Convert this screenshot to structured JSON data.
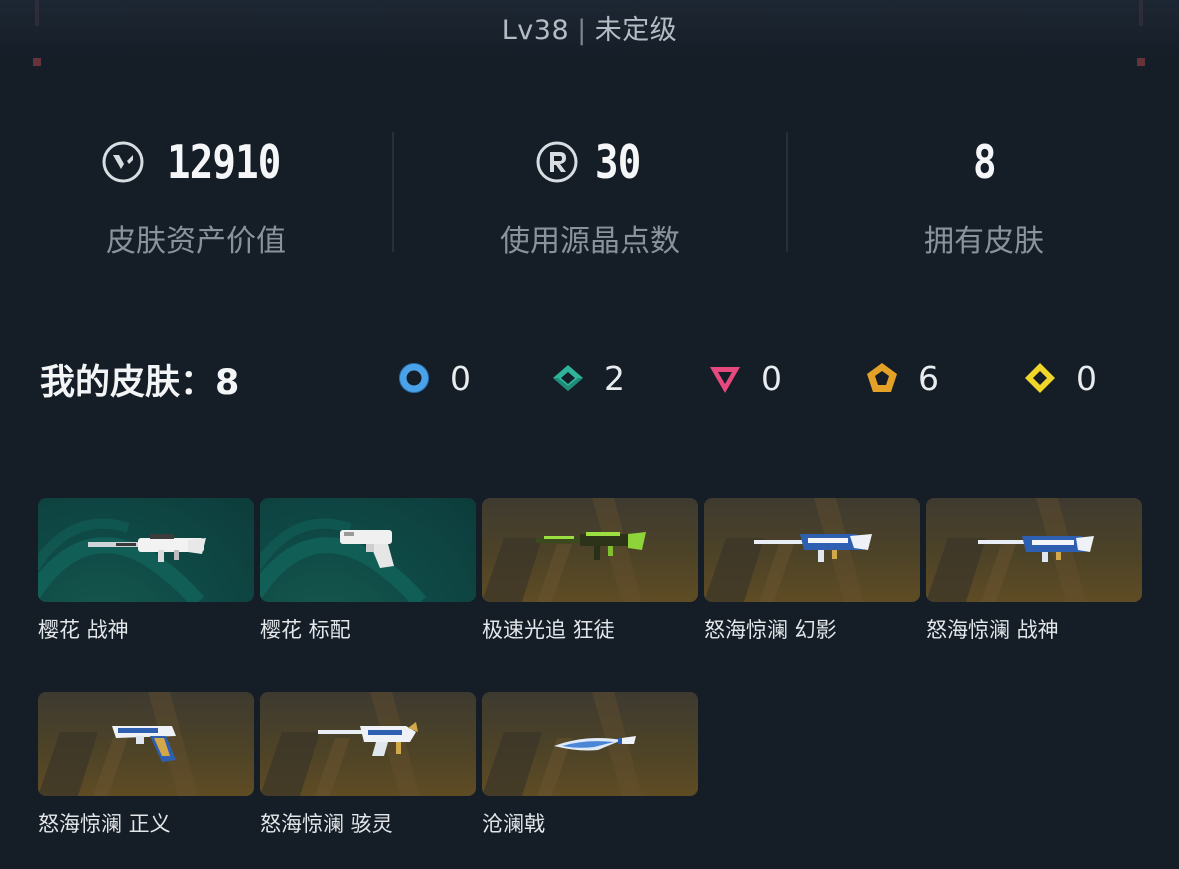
{
  "header": {
    "level": "Lv38",
    "rank": "未定级"
  },
  "stats": [
    {
      "value": "12910",
      "label": "皮肤资产价值",
      "icon": "valorant-points-icon"
    },
    {
      "value": "30",
      "label": "使用源晶点数",
      "icon": "radianite-points-icon"
    },
    {
      "value": "8",
      "label": "拥有皮肤",
      "icon": ""
    }
  ],
  "skins_summary": {
    "title": "我的皮肤：8",
    "rarities": [
      {
        "count": "0",
        "icon": "select-tier-icon",
        "color": "#4aa3e8"
      },
      {
        "count": "2",
        "icon": "deluxe-tier-icon",
        "color": "#2fb39a"
      },
      {
        "count": "0",
        "icon": "premium-tier-icon",
        "color": "#e5497e"
      },
      {
        "count": "6",
        "icon": "exclusive-tier-icon",
        "color": "#e3a227"
      },
      {
        "count": "0",
        "icon": "ultra-tier-icon",
        "color": "#f0d629"
      }
    ]
  },
  "skins": [
    {
      "name": "樱花 战神",
      "theme": "teal",
      "weapon": "rifle-white"
    },
    {
      "name": "樱花 标配",
      "theme": "teal",
      "weapon": "pistol-white"
    },
    {
      "name": "极速光追 狂徒",
      "theme": "gold",
      "weapon": "rifle-green"
    },
    {
      "name": "怒海惊澜 幻影",
      "theme": "gold",
      "weapon": "rifle-blue"
    },
    {
      "name": "怒海惊澜 战神",
      "theme": "gold",
      "weapon": "rifle-blue"
    },
    {
      "name": "怒海惊澜 正义",
      "theme": "gold",
      "weapon": "pistol-blue"
    },
    {
      "name": "怒海惊澜 骇灵",
      "theme": "gold",
      "weapon": "smg-blue"
    },
    {
      "name": "沧澜戟",
      "theme": "gold",
      "weapon": "knife-blue"
    }
  ]
}
